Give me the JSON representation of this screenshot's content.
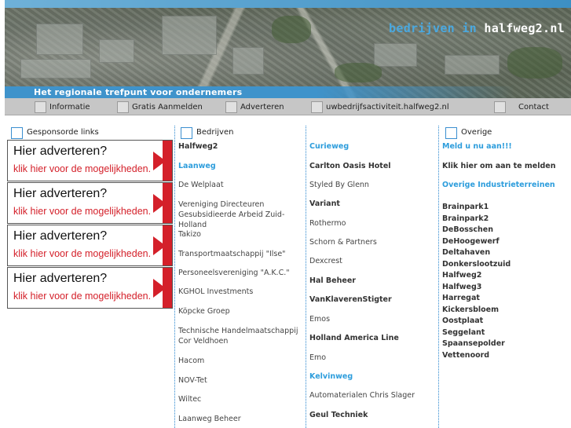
{
  "header": {
    "title_part1": "bedrijven in",
    "title_part2": "halfweg2.nl",
    "tagline": "Het regionale trefpunt voor ondernemers"
  },
  "nav": {
    "items": [
      {
        "label": "Informatie"
      },
      {
        "label": "Gratis Aanmelden"
      },
      {
        "label": "Adverteren"
      },
      {
        "label": "uwbedrijfsactiviteit.halfweg2.nl"
      },
      {
        "label": "Contact"
      }
    ]
  },
  "sponsored": {
    "heading": "Gesponsorde links",
    "ads": [
      {
        "title": "Hier adverteren?",
        "subtitle": "klik hier voor de mogelijkheden."
      },
      {
        "title": "Hier adverteren?",
        "subtitle": "klik hier voor de mogelijkheden."
      },
      {
        "title": "Hier adverteren?",
        "subtitle": "klik hier voor de mogelijkheden."
      },
      {
        "title": "Hier adverteren?",
        "subtitle": "klik hier voor de mogelijkheden."
      }
    ]
  },
  "bedrijven": {
    "heading": "Bedrijven",
    "col1": [
      {
        "text": "Halfweg2",
        "style": "bold"
      },
      {
        "text": "Laanweg",
        "style": "blue"
      },
      {
        "text": "De Welplaat",
        "style": "normal"
      },
      {
        "text": "Vereniging Directeuren Gesubsidieerde Arbeid Zuid-Holland",
        "style": "wrap"
      },
      {
        "text": "Takizo",
        "style": "normal"
      },
      {
        "text": "Transportmaatschappij \"Ilse\"",
        "style": "normal"
      },
      {
        "text": "Personeelsvereniging \"A.K.C.\"",
        "style": "normal"
      },
      {
        "text": "KGHOL Investments",
        "style": "normal"
      },
      {
        "text": "Köpcke Groep",
        "style": "normal"
      },
      {
        "text": "Technische Handelmaatschappij Cor Veldhoen",
        "style": "wrap"
      },
      {
        "text": "Hacom",
        "style": "normal"
      },
      {
        "text": "NOV-Tet",
        "style": "normal"
      },
      {
        "text": "Wiltec",
        "style": "normal"
      },
      {
        "text": "Laanweg Beheer",
        "style": "normal"
      }
    ],
    "col2": [
      {
        "text": "Curieweg",
        "style": "blue"
      },
      {
        "text": "Carlton Oasis Hotel",
        "style": "bold"
      },
      {
        "text": "Styled By Glenn",
        "style": "normal"
      },
      {
        "text": "Variant",
        "style": "bold"
      },
      {
        "text": "Rothermo",
        "style": "normal"
      },
      {
        "text": "Schorn & Partners",
        "style": "normal"
      },
      {
        "text": "Dexcrest",
        "style": "normal"
      },
      {
        "text": "Hal Beheer",
        "style": "bold"
      },
      {
        "text": "VanKlaverenStigter",
        "style": "bold"
      },
      {
        "text": "Emos",
        "style": "normal"
      },
      {
        "text": "Holland America Line",
        "style": "bold"
      },
      {
        "text": "Emo",
        "style": "normal"
      },
      {
        "text": "Kelvinweg",
        "style": "blue"
      },
      {
        "text": "Automaterialen Chris Slager",
        "style": "normal"
      },
      {
        "text": "Geul Techniek",
        "style": "bold"
      }
    ]
  },
  "overige": {
    "heading": "Overige",
    "meld": "Meld u nu aan!!!",
    "klik": "Klik hier om aan te melden",
    "industrie": "Overige Industrieterreinen",
    "areas": [
      "Brainpark1",
      "Brainpark2",
      "DeBosschen",
      "DeHoogewerf",
      "Deltahaven",
      "Donkerslootzuid",
      "Halfweg2",
      "Halfweg3",
      "Harregat",
      "Kickersbloem",
      "Oostplaat",
      "Seggelant",
      "Spaansepolder",
      "Vettenoord"
    ]
  },
  "colors": {
    "accent_blue": "#2d9ddc",
    "ad_red": "#d4202a",
    "nav_gray": "#c6c6c6"
  }
}
